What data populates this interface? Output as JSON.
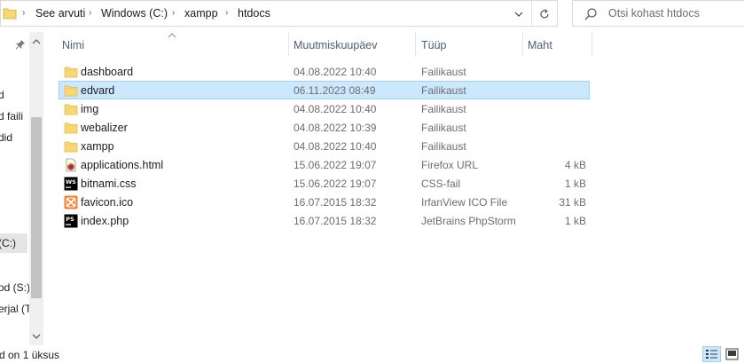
{
  "address_bar": {
    "breadcrumbs": [
      "See arvuti",
      "Windows (C:)",
      "xampp",
      "htdocs"
    ]
  },
  "search": {
    "placeholder": "Otsi kohast htdocs"
  },
  "nav_pane": {
    "items": [
      "d",
      "d faili",
      "did",
      "(C:)",
      "od (S:)",
      "erjal (T"
    ]
  },
  "columns": {
    "name": "Nimi",
    "date": "Muutmiskuupäev",
    "type": "Tüüp",
    "size": "Maht"
  },
  "files": [
    {
      "name": "dashboard",
      "date": "04.08.2022 10:40",
      "type": "Failikaust",
      "size": "",
      "icon": "folder-icon"
    },
    {
      "name": "edvard",
      "date": "06.11.2023 08:49",
      "type": "Failikaust",
      "size": "",
      "icon": "folder-icon"
    },
    {
      "name": "img",
      "date": "04.08.2022 10:40",
      "type": "Failikaust",
      "size": "",
      "icon": "folder-icon"
    },
    {
      "name": "webalizer",
      "date": "04.08.2022 10:39",
      "type": "Failikaust",
      "size": "",
      "icon": "folder-icon"
    },
    {
      "name": "xampp",
      "date": "04.08.2022 10:40",
      "type": "Failikaust",
      "size": "",
      "icon": "folder-icon"
    },
    {
      "name": "applications.html",
      "date": "15.06.2022 19:07",
      "type": "Firefox URL",
      "size": "4 kB",
      "icon": "firefox-html-icon"
    },
    {
      "name": "bitnami.css",
      "date": "15.06.2022 19:07",
      "type": "CSS-fail",
      "size": "1 kB",
      "icon": "webstorm-icon"
    },
    {
      "name": "favicon.ico",
      "date": "16.07.2015 18:32",
      "type": "IrfanView ICO File",
      "size": "31 kB",
      "icon": "xampp-icon"
    },
    {
      "name": "index.php",
      "date": "16.07.2015 18:32",
      "type": "JetBrains PhpStorm",
      "size": "1 kB",
      "icon": "phpstorm-icon"
    }
  ],
  "selected_file": "edvard",
  "status_bar": {
    "text": "d on 1 üksus"
  },
  "colors": {
    "selection_bg": "#cce8ff",
    "selection_border": "#99d1ff",
    "header_text": "#4c607a",
    "folder": "#f8d775"
  }
}
